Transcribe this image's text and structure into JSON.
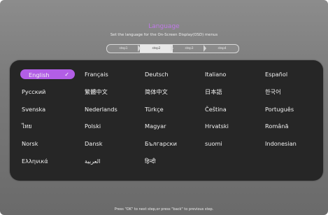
{
  "header": {
    "title": "Language",
    "subtitle": "Set the language for the On-Screen Display(OSD) menus"
  },
  "steps": [
    {
      "label": "step1",
      "active": false
    },
    {
      "label": "step2",
      "active": true
    },
    {
      "label": "step3",
      "active": false
    },
    {
      "label": "step4",
      "active": false
    }
  ],
  "languages": [
    "English",
    "Français",
    "Deutsch",
    "Italiano",
    "Español",
    "Русский",
    "繁體中文",
    "简体中文",
    "日本語",
    "한국어",
    "Svenska",
    "Nederlands",
    "Türkçe",
    "Čeština",
    "Português",
    "ไทย",
    "Polski",
    "Magyar",
    "Hrvatski",
    "Română",
    "Norsk",
    "Dansk",
    "Български",
    "suomi",
    "Indonesian",
    "Ελληνικά",
    "العربية",
    "हिन्दी"
  ],
  "selected_language": "English",
  "footer": {
    "hint": "Press \"OK\" to next step,or press \"back\" to previous step."
  },
  "colors": {
    "accent": "#b25ee6",
    "title": "#c07ae8",
    "panel": "#262626"
  },
  "icons": {
    "selected_mark": "check-icon"
  }
}
